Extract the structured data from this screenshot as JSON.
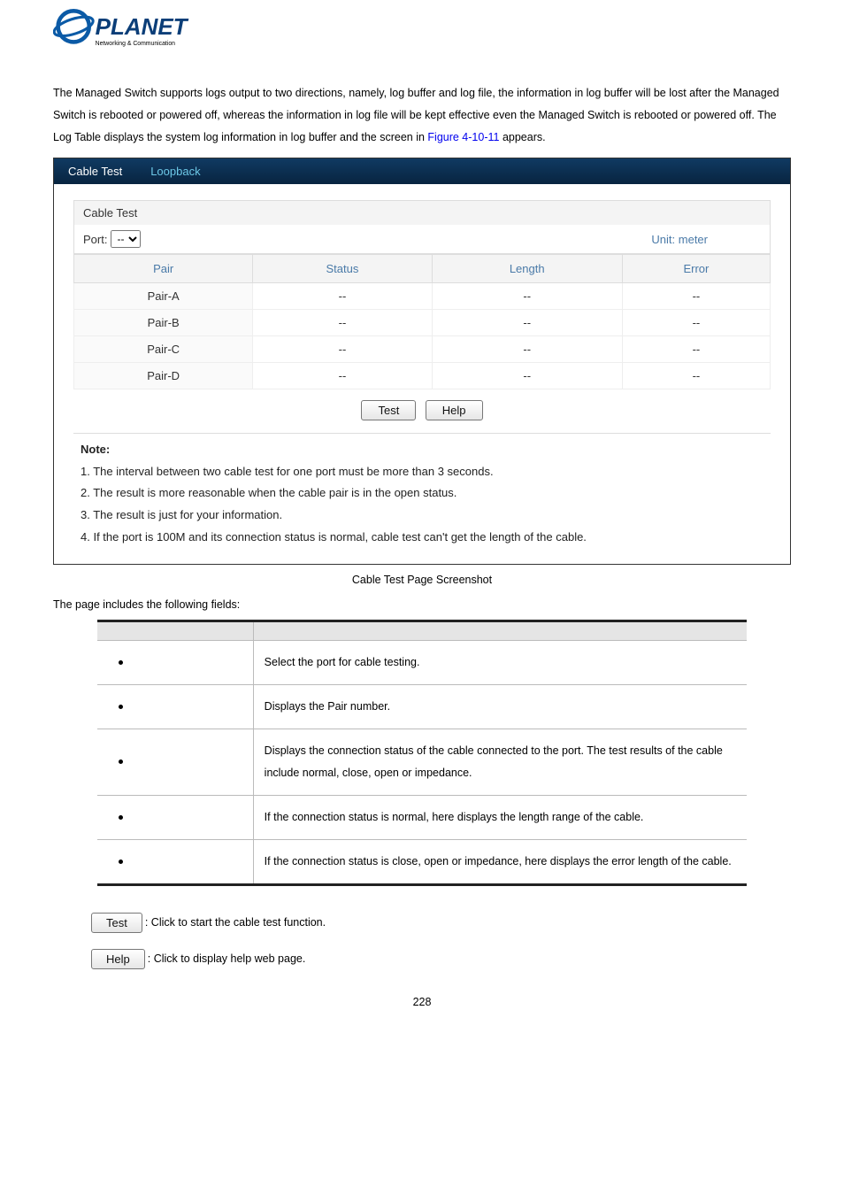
{
  "logo": {
    "brand": "PLANET",
    "tagline": "Networking & Communication"
  },
  "intro": {
    "text_a": "The Managed Switch supports logs output to two directions, namely, log buffer and log file, the information in log buffer will be lost after the Managed Switch is rebooted or powered off, whereas the information in log file will be kept effective even the Managed Switch is rebooted or powered off. The Log Table displays the system log information in log buffer and the screen in ",
    "figref": "Figure 4-10-11",
    "text_b": " appears."
  },
  "screenshot": {
    "tabs": {
      "cabletest": "Cable Test",
      "loopback": "Loopback"
    },
    "section_title": "Cable Test",
    "port_label": "Port:",
    "port_value": "--",
    "unit_label": "Unit: meter",
    "headers": {
      "pair": "Pair",
      "status": "Status",
      "length": "Length",
      "error": "Error"
    },
    "rows": [
      {
        "pair": "Pair-A",
        "status": "--",
        "length": "--",
        "error": "--"
      },
      {
        "pair": "Pair-B",
        "status": "--",
        "length": "--",
        "error": "--"
      },
      {
        "pair": "Pair-C",
        "status": "--",
        "length": "--",
        "error": "--"
      },
      {
        "pair": "Pair-D",
        "status": "--",
        "length": "--",
        "error": "--"
      }
    ],
    "buttons": {
      "test": "Test",
      "help": "Help"
    },
    "notes": {
      "heading": "Note:",
      "n1": "1. The interval between two cable test for one port must be more than 3 seconds.",
      "n2": "2. The result is more reasonable when the cable pair is in the open status.",
      "n3": "3. The result is just for your information.",
      "n4": "4. If the port is 100M and its connection status is normal, cable test can't get the length of the cable."
    }
  },
  "caption": "Cable Test Page Screenshot",
  "fields_intro": "The page includes the following fields:",
  "param_table": {
    "h1": "",
    "h2": "",
    "rows": [
      {
        "obj": "",
        "desc": "Select the port for cable testing."
      },
      {
        "obj": "",
        "desc": "Displays the Pair number."
      },
      {
        "obj": "",
        "desc": "Displays the connection status of the cable connected to the port. The test results of the cable include normal, close, open or impedance."
      },
      {
        "obj": "",
        "desc": "If the connection status is normal, here displays the length range of the cable."
      },
      {
        "obj": "",
        "desc": "If the connection status is close, open or impedance, here displays the error length of the cable."
      }
    ]
  },
  "button_desc": {
    "test_btn": "Test",
    "test_txt": ": Click to start the cable test function.",
    "help_btn": "Help",
    "help_txt": ": Click to display help web page."
  },
  "page_number": "228"
}
